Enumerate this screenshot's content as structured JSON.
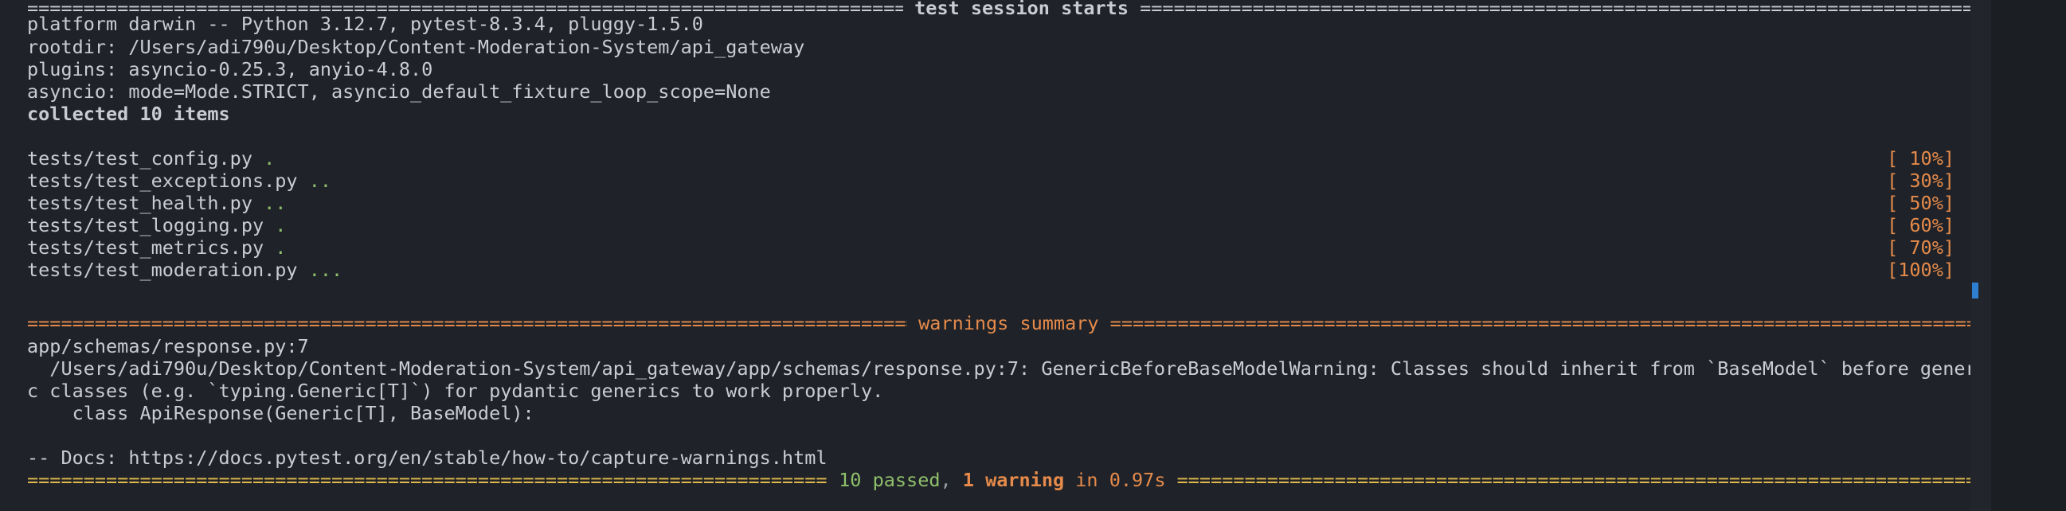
{
  "session": {
    "header_title": " test session starts ",
    "platform": "platform darwin -- Python 3.12.7, pytest-8.3.4, pluggy-1.5.0",
    "rootdir": "rootdir: /Users/adi790u/Desktop/Content-Moderation-System/api_gateway",
    "plugins": "plugins: asyncio-0.25.3, anyio-4.8.0",
    "asyncio": "asyncio: mode=Mode.STRICT, asyncio_default_fixture_loop_scope=None",
    "collected": "collected 10 items"
  },
  "tests": [
    {
      "file": "tests/test_config.py",
      "dots": ".",
      "progress": "[ 10%]"
    },
    {
      "file": "tests/test_exceptions.py",
      "dots": "..",
      "progress": "[ 30%]"
    },
    {
      "file": "tests/test_health.py",
      "dots": "..",
      "progress": "[ 50%]"
    },
    {
      "file": "tests/test_logging.py",
      "dots": ".",
      "progress": "[ 60%]"
    },
    {
      "file": "tests/test_metrics.py",
      "dots": ".",
      "progress": "[ 70%]"
    },
    {
      "file": "tests/test_moderation.py",
      "dots": "...",
      "progress": "[100%]"
    }
  ],
  "warnings": {
    "header_title": " warnings summary ",
    "location": "app/schemas/response.py:7",
    "message_line1": "  /Users/adi790u/Desktop/Content-Moderation-System/api_gateway/app/schemas/response.py:7: GenericBeforeBaseModelWarning: Classes should inherit from `BaseModel` before generi",
    "message_line2": "c classes (e.g. `typing.Generic[T]`) for pydantic generics to work properly.",
    "code_line": "    class ApiResponse(Generic[T], BaseModel):",
    "docs": "-- Docs: https://docs.pytest.org/en/stable/how-to/capture-warnings.html"
  },
  "summary": {
    "passed": "10 passed",
    "separator": ", ",
    "warning": "1 warning",
    "time": " in 0.97s "
  },
  "colors": {
    "background": "#1f2329",
    "text": "#c9ccd2",
    "passed": "#8fbf6a",
    "progress": "#e58a4a",
    "scroll_thumb": "#2f7fd1"
  }
}
